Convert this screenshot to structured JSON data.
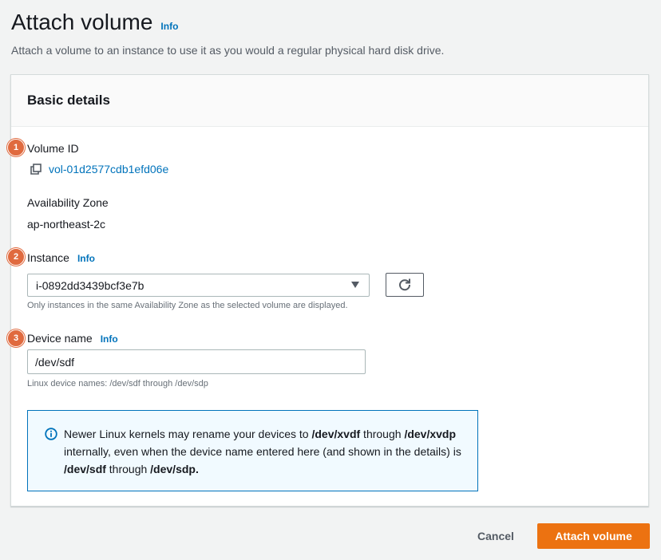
{
  "page": {
    "title": "Attach volume",
    "title_info": "Info",
    "description": "Attach a volume to an instance to use it as you would a regular physical hard disk drive."
  },
  "panel": {
    "header": "Basic details",
    "volume_id": {
      "label": "Volume ID",
      "value": "vol-01d2577cdb1efd06e",
      "icon": "copy-icon"
    },
    "availability_zone": {
      "label": "Availability Zone",
      "value": "ap-northeast-2c"
    },
    "instance": {
      "label": "Instance",
      "info": "Info",
      "selected": "i-0892dd3439bcf3e7b",
      "hint": "Only instances in the same Availability Zone as the selected volume are displayed.",
      "refresh_icon": "refresh-icon"
    },
    "device_name": {
      "label": "Device name",
      "info": "Info",
      "value": "/dev/sdf",
      "hint": "Linux device names: /dev/sdf through /dev/sdp"
    },
    "alert": {
      "icon": "info-circle-icon",
      "t1": "Newer Linux kernels may rename your devices to ",
      "b1": "/dev/xvdf",
      "t2": " through ",
      "b2": "/dev/xvdp",
      "t3": " internally, even when the device name entered here (and shown in the details) is ",
      "b3": "/dev/sdf",
      "t4": " through ",
      "b4": "/dev/sdp."
    }
  },
  "badges": [
    "1",
    "2",
    "3"
  ],
  "footer": {
    "cancel_label": "Cancel",
    "submit_label": "Attach volume"
  },
  "colors": {
    "accent": "#ec7211",
    "link": "#0073bb",
    "badge": "#e06a3f",
    "alert_bg": "#f1faff"
  }
}
